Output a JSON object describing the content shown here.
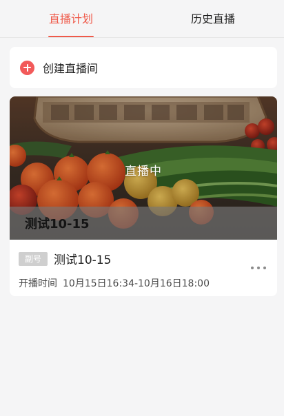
{
  "tabs": [
    {
      "label": "直播计划"
    },
    {
      "label": "历史直播"
    }
  ],
  "create": {
    "label": "创建直播间"
  },
  "live_item": {
    "cover_status": "直播中",
    "cover_title": "测试10-15",
    "badge": "副号",
    "name": "测试10-15",
    "time_label": "开播时间",
    "time_value": "10月15日16:34-10月16日18:00"
  },
  "colors": {
    "accent": "#ef5a4a",
    "plus": "#f25a5a",
    "background": "#f5f5f6"
  },
  "icons": {
    "create": "plus-circle-icon",
    "more": "more-dots-icon"
  }
}
